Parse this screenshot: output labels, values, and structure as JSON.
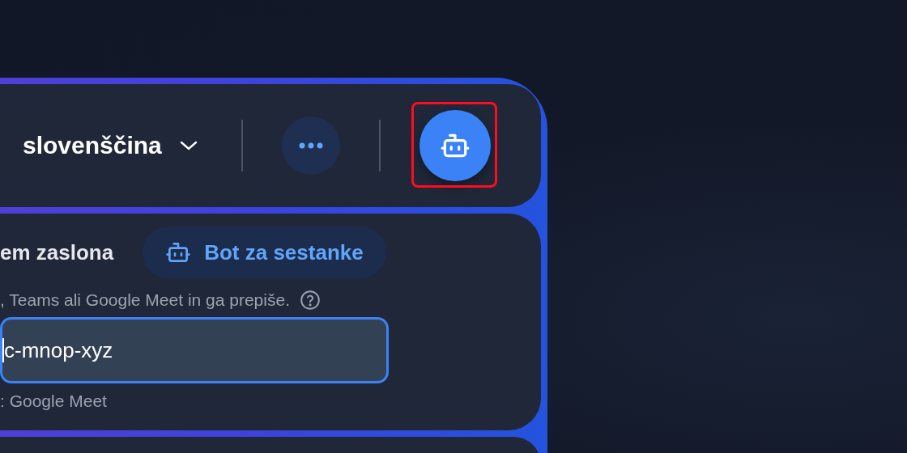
{
  "header": {
    "language": "slovenščina",
    "bot_button": {
      "highlighted": true
    }
  },
  "bot_section": {
    "title": "em zaslona",
    "mode_button": {
      "label": "Bot za sestanke"
    },
    "description": ", Teams ali Google Meet in ga prepiše.",
    "meeting_link": {
      "value": "c-mnop-xyz",
      "focused": true
    },
    "detected_platform": ": Google Meet"
  }
}
